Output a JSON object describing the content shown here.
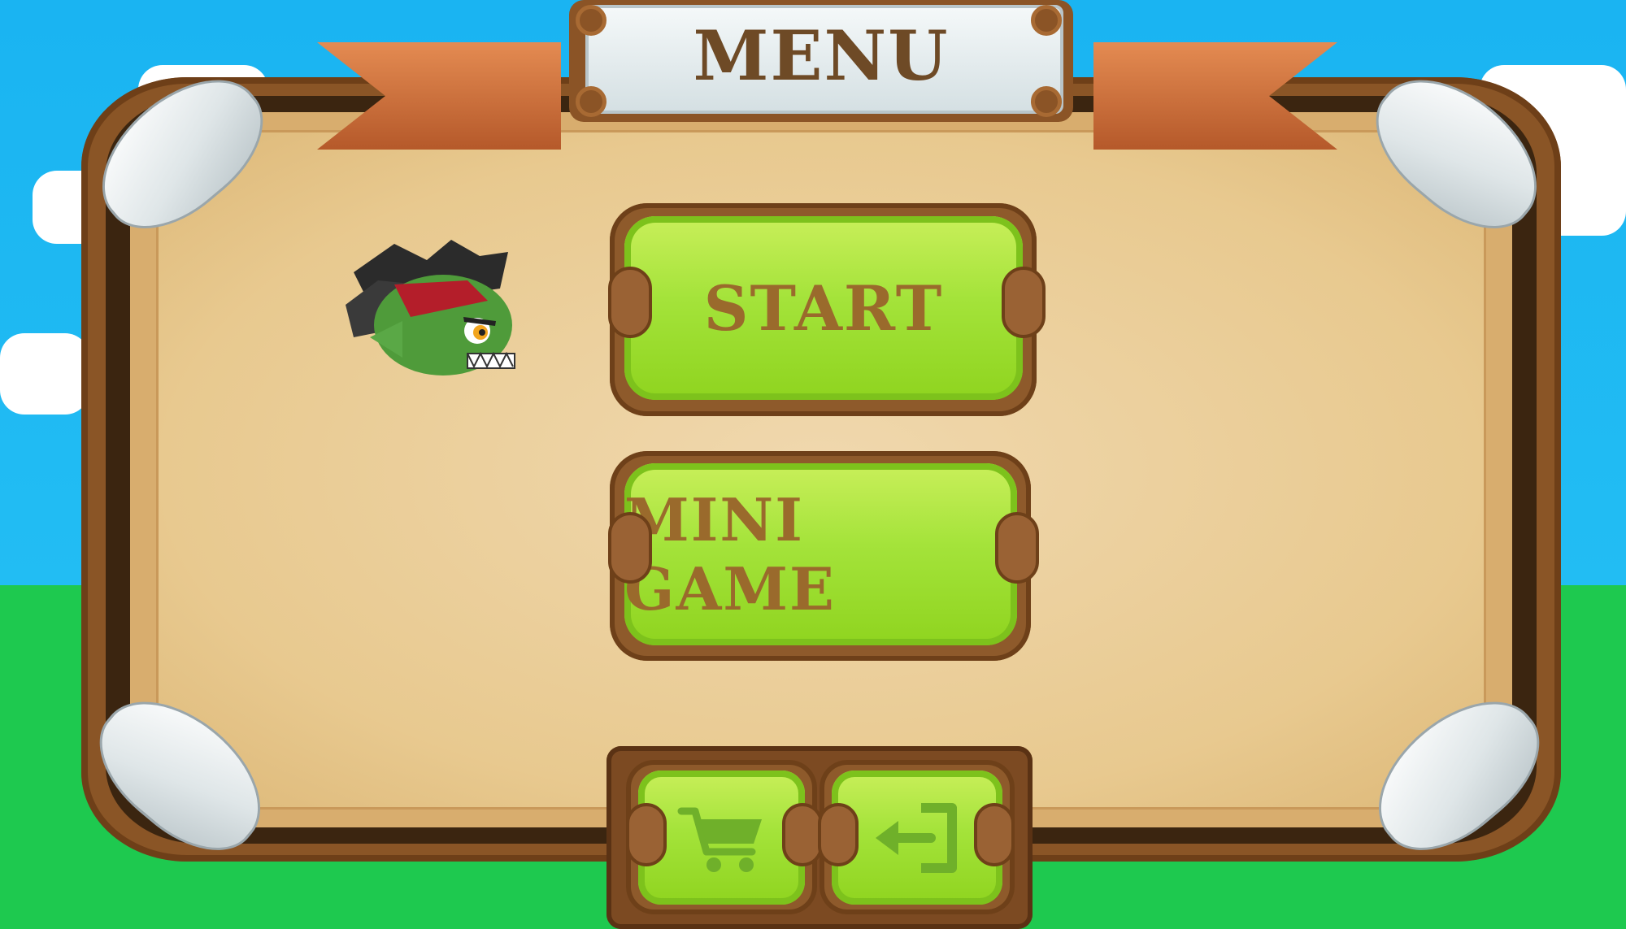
{
  "menu": {
    "title": "MENU",
    "buttons": {
      "start_label": "START",
      "mini_game_label": "MINI GAME"
    },
    "icons": {
      "shop": "cart-icon",
      "exit": "exit-icon"
    }
  },
  "colors": {
    "sky": "#1ab4f2",
    "grass": "#1ec94f",
    "button_green": "#a4e33a",
    "button_text": "#9a6a2c",
    "wood": "#8a5526"
  }
}
